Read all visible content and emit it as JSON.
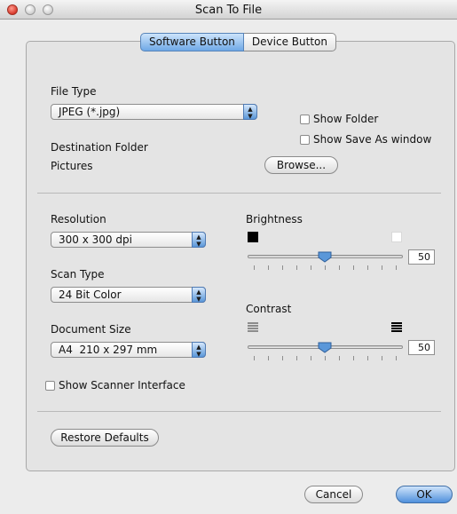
{
  "window": {
    "title": "Scan To File"
  },
  "tabs": [
    {
      "label": "Software Button",
      "active": true
    },
    {
      "label": "Device Button",
      "active": false
    }
  ],
  "file_type": {
    "label": "File Type",
    "value": "JPEG (*.jpg)"
  },
  "options": {
    "show_folder": "Show Folder",
    "show_save_as": "Show Save As window"
  },
  "destination": {
    "label": "Destination Folder",
    "value": "Pictures",
    "browse": "Browse..."
  },
  "resolution": {
    "label": "Resolution",
    "value": "300 x 300 dpi"
  },
  "scan_type": {
    "label": "Scan Type",
    "value": "24 Bit Color"
  },
  "document_size": {
    "label": "Document Size",
    "value": "A4  210 x 297 mm"
  },
  "show_scanner_interface": "Show Scanner Interface",
  "brightness": {
    "label": "Brightness",
    "value": "50"
  },
  "contrast": {
    "label": "Contrast",
    "value": "50"
  },
  "buttons": {
    "restore": "Restore Defaults",
    "cancel": "Cancel",
    "ok": "OK"
  },
  "colors": {
    "accent": "#5a97d9"
  },
  "icons": {
    "brightness_low": "black-square-icon",
    "brightness_high": "white-square-icon",
    "contrast_low": "gray-lines-icon",
    "contrast_high": "black-lines-icon"
  }
}
